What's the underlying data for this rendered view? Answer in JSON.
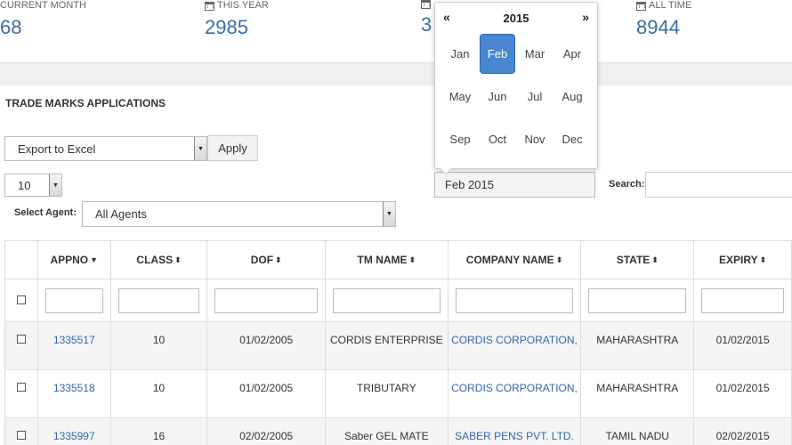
{
  "stats": [
    {
      "label": "CURRENT MONTH",
      "value": "68",
      "icon": null
    },
    {
      "label": "THIS YEAR",
      "value": "2985",
      "icon": "calendar-icon"
    },
    {
      "label": "",
      "value": "3",
      "icon": "calendar-icon"
    },
    {
      "label": "ALL TIME",
      "value": "8944",
      "icon": "calendar-icon"
    }
  ],
  "section": {
    "title": "TRADE MARKS APPLICATIONS"
  },
  "bulk": {
    "selected": "Export to Excel",
    "apply_label": "Apply"
  },
  "page_size": {
    "selected": "10"
  },
  "agent": {
    "label": "Select Agent:",
    "selected": "All Agents"
  },
  "date_filter": {
    "value": "Feb 2015"
  },
  "search": {
    "label": "Search:"
  },
  "picker": {
    "prev": "«",
    "next": "»",
    "year": "2015",
    "months": [
      "Jan",
      "Feb",
      "Mar",
      "Apr",
      "May",
      "Jun",
      "Jul",
      "Aug",
      "Sep",
      "Oct",
      "Nov",
      "Dec"
    ],
    "selected": "Feb"
  },
  "table": {
    "columns": [
      {
        "label": "",
        "sort": ""
      },
      {
        "label": "APPNO",
        "sort": "desc"
      },
      {
        "label": "CLASS",
        "sort": "both"
      },
      {
        "label": "DOF",
        "sort": "both"
      },
      {
        "label": "TM NAME",
        "sort": "both"
      },
      {
        "label": "COMPANY NAME",
        "sort": "both"
      },
      {
        "label": "STATE",
        "sort": "both"
      },
      {
        "label": "EXPIRY",
        "sort": "both"
      }
    ],
    "rows": [
      {
        "appno": "1335517",
        "class": "10",
        "dof": "01/02/2005",
        "tm_name": "CORDIS ENTERPRISE",
        "company": "CORDIS CORPORATION,",
        "state": "MAHARASHTRA",
        "expiry": "01/02/2015"
      },
      {
        "appno": "1335518",
        "class": "10",
        "dof": "01/02/2005",
        "tm_name": "TRIBUTARY",
        "company": "CORDIS CORPORATION,",
        "state": "MAHARASHTRA",
        "expiry": "01/02/2015"
      },
      {
        "appno": "1335997",
        "class": "16",
        "dof": "02/02/2005",
        "tm_name": "Saber GEL MATE",
        "company": "SABER PENS PVT. LTD.",
        "state": "TAMIL NADU",
        "expiry": "02/02/2015"
      }
    ]
  },
  "colors": {
    "accent": "#3a6ea5",
    "link": "#3366aa",
    "selected_month": "#4a86d0"
  }
}
